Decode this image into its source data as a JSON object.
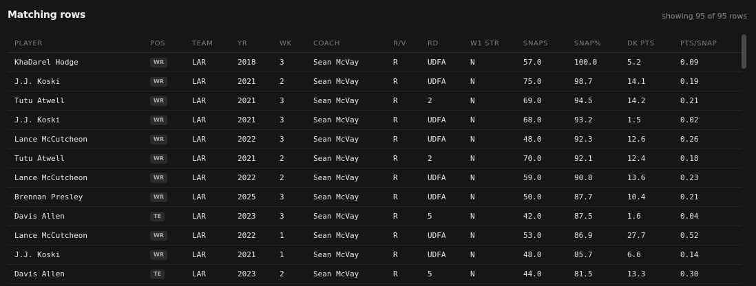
{
  "header": {
    "title": "Matching rows",
    "count_text": "showing 95 of 95 rows"
  },
  "columns": [
    "PLAYER",
    "POS",
    "TEAM",
    "YR",
    "WK",
    "COACH",
    "R/V",
    "RD",
    "W1 STR",
    "SNAPS",
    "SNAP%",
    "DK PTS",
    "PTS/SNAP"
  ],
  "rows": [
    [
      "KhaDarel Hodge",
      "WR",
      "LAR",
      "2018",
      "3",
      "Sean McVay",
      "R",
      "UDFA",
      "N",
      "57.0",
      "100.0",
      "5.2",
      "0.09"
    ],
    [
      "J.J. Koski",
      "WR",
      "LAR",
      "2021",
      "2",
      "Sean McVay",
      "R",
      "UDFA",
      "N",
      "75.0",
      "98.7",
      "14.1",
      "0.19"
    ],
    [
      "Tutu Atwell",
      "WR",
      "LAR",
      "2021",
      "3",
      "Sean McVay",
      "R",
      "2",
      "N",
      "69.0",
      "94.5",
      "14.2",
      "0.21"
    ],
    [
      "J.J. Koski",
      "WR",
      "LAR",
      "2021",
      "3",
      "Sean McVay",
      "R",
      "UDFA",
      "N",
      "68.0",
      "93.2",
      "1.5",
      "0.02"
    ],
    [
      "Lance McCutcheon",
      "WR",
      "LAR",
      "2022",
      "3",
      "Sean McVay",
      "R",
      "UDFA",
      "N",
      "48.0",
      "92.3",
      "12.6",
      "0.26"
    ],
    [
      "Tutu Atwell",
      "WR",
      "LAR",
      "2021",
      "2",
      "Sean McVay",
      "R",
      "2",
      "N",
      "70.0",
      "92.1",
      "12.4",
      "0.18"
    ],
    [
      "Lance McCutcheon",
      "WR",
      "LAR",
      "2022",
      "2",
      "Sean McVay",
      "R",
      "UDFA",
      "N",
      "59.0",
      "90.8",
      "13.6",
      "0.23"
    ],
    [
      "Brennan Presley",
      "WR",
      "LAR",
      "2025",
      "3",
      "Sean McVay",
      "R",
      "UDFA",
      "N",
      "50.0",
      "87.7",
      "10.4",
      "0.21"
    ],
    [
      "Davis Allen",
      "TE",
      "LAR",
      "2023",
      "3",
      "Sean McVay",
      "R",
      "5",
      "N",
      "42.0",
      "87.5",
      "1.6",
      "0.04"
    ],
    [
      "Lance McCutcheon",
      "WR",
      "LAR",
      "2022",
      "1",
      "Sean McVay",
      "R",
      "UDFA",
      "N",
      "53.0",
      "86.9",
      "27.7",
      "0.52"
    ],
    [
      "J.J. Koski",
      "WR",
      "LAR",
      "2021",
      "1",
      "Sean McVay",
      "R",
      "UDFA",
      "N",
      "48.0",
      "85.7",
      "6.6",
      "0.14"
    ],
    [
      "Davis Allen",
      "TE",
      "LAR",
      "2023",
      "2",
      "Sean McVay",
      "R",
      "5",
      "N",
      "44.0",
      "81.5",
      "13.3",
      "0.30"
    ]
  ]
}
